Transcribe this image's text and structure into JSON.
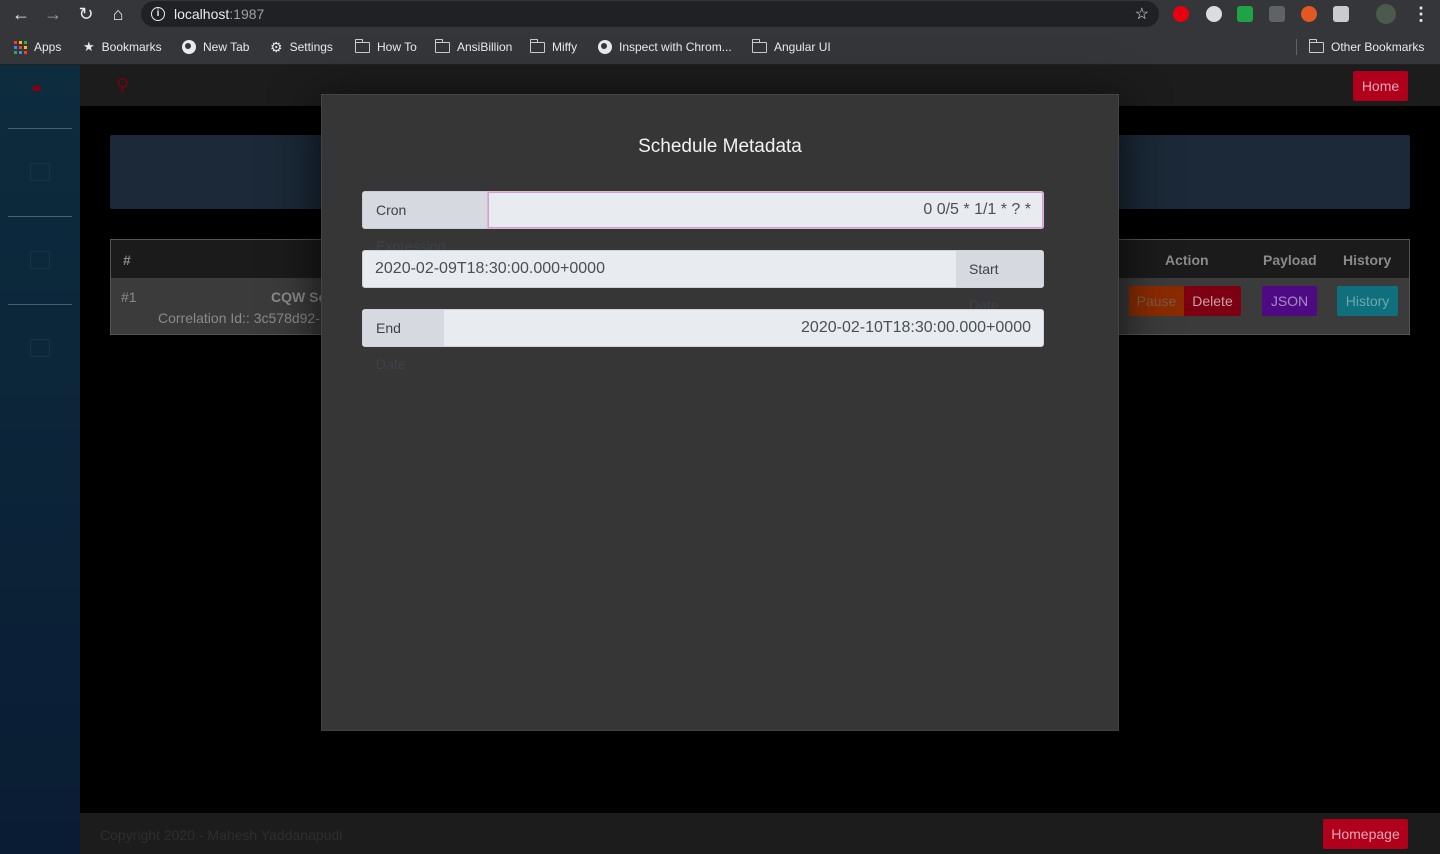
{
  "browser": {
    "url_host": "localhost",
    "url_port": ":1987",
    "bookmarks": [
      {
        "label": "Apps",
        "icon": "apps-icon"
      },
      {
        "label": "Bookmarks",
        "icon": "star-icon"
      },
      {
        "label": "New Tab",
        "icon": "globe-icon"
      },
      {
        "label": "Settings",
        "icon": "gear-icon"
      },
      {
        "label": "How To",
        "icon": "folder-icon"
      },
      {
        "label": "AnsiBillion",
        "icon": "folder-icon"
      },
      {
        "label": "Miffy",
        "icon": "folder-icon"
      },
      {
        "label": "Inspect with Chrom...",
        "icon": "globe-icon"
      },
      {
        "label": "Angular UI",
        "icon": "folder-icon"
      }
    ],
    "other_bookmarks": "Other Bookmarks"
  },
  "app": {
    "home_button": "Home",
    "table": {
      "headers": {
        "index": "#",
        "action": "Action",
        "payload": "Payload",
        "history": "History"
      },
      "row": {
        "index": "#1",
        "name": "CQW Sc",
        "correlation": "Correlation Id:: 3c578d92-",
        "pause": "Pause",
        "delete": "Delete",
        "json": "JSON",
        "history": "History"
      }
    },
    "footer": {
      "copyright": "Copyright 2020 - Mahesh Yaddanapudi",
      "homepage_button": "Homepage"
    }
  },
  "modal": {
    "title": "Schedule Metadata",
    "cron": {
      "label": "Cron Expression",
      "value": "0 0/5 * 1/1 * ? *"
    },
    "start": {
      "label": "Start Date",
      "value": "2020-02-09T18:30:00.000+0000"
    },
    "end": {
      "label": "End Date",
      "value": "2020-02-10T18:30:00.000+0000"
    }
  },
  "colors": {
    "brand_red": "#b0001c",
    "modal_bg": "#363636",
    "input_bg": "#e8ebef",
    "json_purple": "#6a0dad",
    "history_blue": "#17a2b8"
  }
}
